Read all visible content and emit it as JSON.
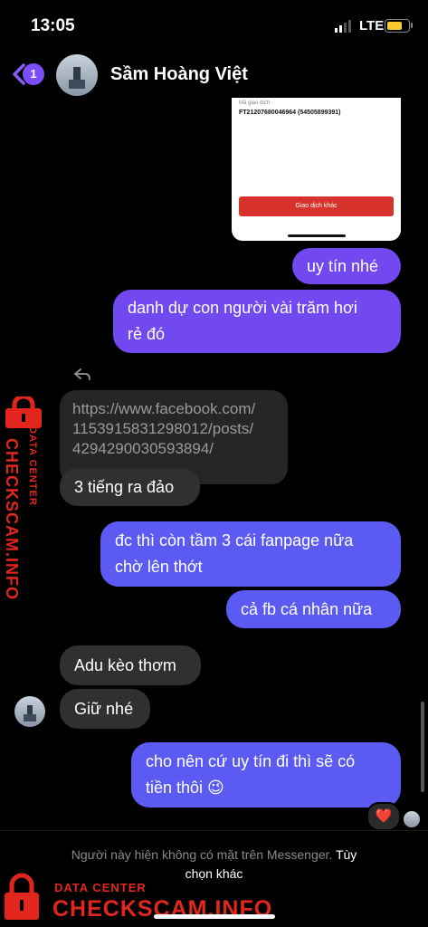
{
  "status_bar": {
    "time": "13:05",
    "network": "LTE"
  },
  "header": {
    "unread_badge": "1",
    "contact_name": "Sầm Hoàng Việt"
  },
  "shared_card": {
    "label": "Mã giao dịch",
    "transaction_id": "FT21207680046964 (54505899391)",
    "button": "Giao dịch khác"
  },
  "messages": [
    {
      "dir": "out",
      "text": "uy tín nhé"
    },
    {
      "dir": "out",
      "lines": [
        "danh dự con người vài trăm hơi",
        "rẻ đó"
      ]
    },
    {
      "dir": "in",
      "lines": [
        "https://www.facebook.com/",
        "115391583129801​2/posts/",
        "4294290030593894/"
      ]
    },
    {
      "dir": "in",
      "text": "3 tiếng ra đảo"
    },
    {
      "dir": "out",
      "lines": [
        "đc thì còn tầm 3 cái fanpage nữa",
        "chờ lên thớt"
      ]
    },
    {
      "dir": "out",
      "text": "cả fb cá nhân nữa"
    },
    {
      "dir": "in",
      "text": "Adu kèo thơm"
    },
    {
      "dir": "in",
      "text": "Giữ nhé"
    },
    {
      "dir": "out",
      "lines": [
        "cho nên cứ uy tín đi thì sẽ có",
        "tiền thôi 😉"
      ]
    }
  ],
  "reaction": "❤️",
  "footer": {
    "notice": "Người này hiện không có mặt trên Messenger.",
    "option_part1": "Tùy",
    "option_part2": "chọn khác"
  },
  "watermark": {
    "side_small": "DATA CENTER",
    "side_big": "CHECKSCAM.INFO",
    "bottom_small": "DATA CENTER",
    "bottom_big": "CHECKSCAM.INFO"
  },
  "colors": {
    "background": "#000000",
    "outgoing_purple": "#7248f0",
    "outgoing_blue": "#5b5af3",
    "incoming": "#303030",
    "watermark_red": "#e3261d",
    "back_arrow": "#8b5cf6"
  }
}
